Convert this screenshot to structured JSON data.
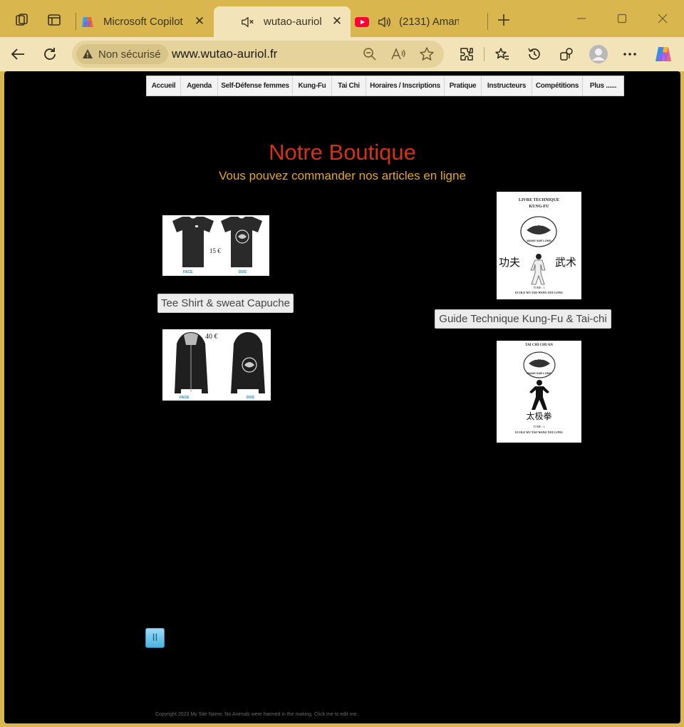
{
  "browser": {
    "tabs": [
      {
        "title": "Microsoft Copilot",
        "icon": "copilot-icon",
        "active": false
      },
      {
        "title": "wutao-auriol",
        "icon": "speaker-muted-icon",
        "active": true
      },
      {
        "title": "(2131) Aman",
        "icon": "youtube-icon",
        "active": false
      }
    ],
    "security_label": "Non sécurisé",
    "url": "www.wutao-auriol.fr"
  },
  "page": {
    "nav": [
      "Accueil",
      "Agenda",
      "Self-Défense femmes",
      "Kung-Fu",
      "Tai Chi",
      "Horaires / Inscriptions",
      "Pratique",
      "Instructeurs",
      "Compétitions",
      "Plus ......"
    ],
    "title": "Notre Boutique",
    "subtitle": "Vous pouvez commander nos articles en ligne",
    "products_left": {
      "tshirt": {
        "price": "15 €",
        "face": "FACE",
        "dos": "DOS"
      },
      "button": "Tee Shirt & sweat Capuche",
      "hoodie": {
        "price": "40 €",
        "face": "FACE",
        "dos": "DOS"
      }
    },
    "products_right": {
      "book1": {
        "title_line1": "LIVRE TECHNIQUE",
        "title_line2": "KUNG-FU",
        "logo_line1": "WU TAO",
        "logo_line2": "WANG XUE LONG",
        "chars_left": "功夫",
        "chars_right": "武术",
        "tome": "TOME : 1",
        "school": "ECOLE WU TAO WANG XUE LONG"
      },
      "button": "Guide Technique Kung-Fu & Tai-chi",
      "book2": {
        "title": "TAI CHI CHUAN",
        "logo_line1": "WU TAO",
        "logo_line2": "WANG XUE LONG",
        "chars": "太极拳",
        "tome": "TOME : 1",
        "school": "ECOLE WU TAO WANG XUE LONG"
      }
    },
    "pause_symbol": "II",
    "footer": "Copyright 2023 My Site Name. No Animals were harmed in the making. Click me to edit me."
  },
  "colors": {
    "chrome": "#d9b64e",
    "toolbar": "#f2e4b8",
    "title": "#d2321a",
    "subtitle": "#e3a825"
  }
}
